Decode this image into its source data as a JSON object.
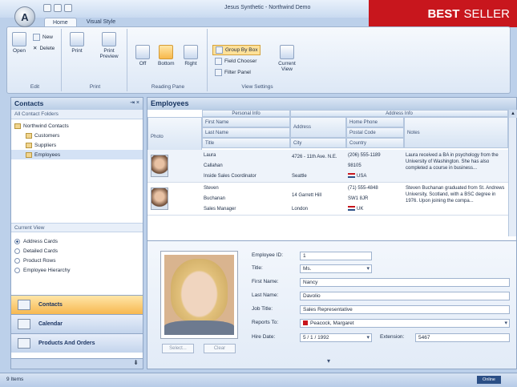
{
  "window": {
    "title": "Jesus Synthetic - Northwind Demo",
    "badge_bold": "BEST",
    "badge_rest": "SELLER"
  },
  "app_orb": {
    "glyph": "A"
  },
  "ribbon": {
    "tabs": [
      "Home",
      "Visual Style"
    ],
    "edit_group": {
      "label": "Edit",
      "open": "Open",
      "new": "New",
      "delete": "Delete"
    },
    "print_group": {
      "label": "Print",
      "print": "Print",
      "print_preview": "Print Preview"
    },
    "reading_pane_group": {
      "label": "Reading Pane",
      "off": "Off",
      "bottom": "Bottom",
      "right": "Right"
    },
    "view_settings_group": {
      "label": "View Settings",
      "group_by_box": "Group By Box",
      "field_chooser": "Field Chooser",
      "filter_panel": "Filter Panel",
      "current_view": "Current View"
    }
  },
  "contacts_panel": {
    "title": "Contacts",
    "controls": "⇥ ×",
    "folders_header": "All Contact Folders",
    "tree": [
      "Northwind Contacts",
      "Customers",
      "Suppliers",
      "Employees"
    ],
    "current_view_header": "Current View",
    "views": [
      "Address Cards",
      "Detailed Cards",
      "Product Rows",
      "Employee Hierarchy"
    ],
    "nav": [
      "Contacts",
      "Calendar",
      "Products And Orders"
    ],
    "footer_glyph": "⇟"
  },
  "employees_panel": {
    "title": "Employees",
    "band_personal": "Personal Info",
    "band_address": "Address Info",
    "headers": {
      "photo": "Photo",
      "first_name": "First Name",
      "last_name": "Last Name",
      "title": "Title",
      "address": "Address",
      "city": "City",
      "home_phone": "Home Phone",
      "postal_code": "Postal Code",
      "country": "Country",
      "notes": "Notes"
    },
    "rows": [
      {
        "first": "Laura",
        "last": "Callahan",
        "title": "Inside Sales Coordinator",
        "address": "4726 - 11th Ave. N.E.",
        "city": "Seattle",
        "phone": "(206) 555-1189",
        "postal": "98105",
        "country": "USA",
        "notes": "Laura received a BA in psychology from the University of Washington. She has also completed a course in business..."
      },
      {
        "first": "Steven",
        "last": "Buchanan",
        "title": "Sales Manager",
        "address": "14 Garrett Hill",
        "city": "London",
        "phone": "(71) 555-4848",
        "postal": "SW1 8JR",
        "country": "UK",
        "notes": "Steven Buchanan graduated from St. Andrews University, Scotland, with a BSC degree in 1976. Upon joining the compa..."
      }
    ]
  },
  "detail_form": {
    "select_btn": "Select...",
    "clear_btn": "Clear",
    "labels": {
      "employee_id": "Employee ID:",
      "title": "Title:",
      "first_name": "First Name:",
      "last_name": "Last Name:",
      "job_title": "Job Title:",
      "reports_to": "Reports To:",
      "hire_date": "Hire Date:",
      "extension": "Extension:"
    },
    "values": {
      "employee_id": "1",
      "title": "Ms.",
      "first_name": "Nancy",
      "last_name": "Davolio",
      "job_title": "Sales Representative",
      "reports_to": "Peacock, Margaret",
      "hire_date": "5 / 1 / 1992",
      "extension": "5467"
    },
    "expand_glyph": "▾"
  },
  "status_bar": {
    "left": "9 Items",
    "right": "Online"
  },
  "colors": {
    "accent": "#f7b850",
    "brand_red": "#c8161d",
    "header_blue": "#15325e"
  }
}
